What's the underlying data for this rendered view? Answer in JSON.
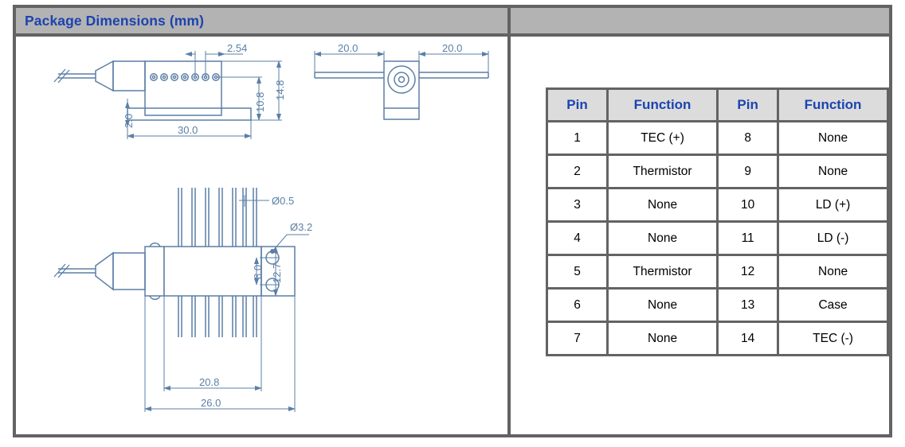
{
  "header": {
    "title": "Package Dimensions (mm)",
    "right_title": ""
  },
  "pin_table": {
    "columns": [
      "Pin",
      "Function",
      "Pin",
      "Function"
    ],
    "rows": [
      [
        "1",
        "TEC (+)",
        "8",
        "None"
      ],
      [
        "2",
        "Thermistor",
        "9",
        "None"
      ],
      [
        "3",
        "None",
        "10",
        "LD (+)"
      ],
      [
        "4",
        "None",
        "11",
        "LD (-)"
      ],
      [
        "5",
        "Thermistor",
        "12",
        "None"
      ],
      [
        "6",
        "None",
        "13",
        "Case"
      ],
      [
        "7",
        "None",
        "14",
        "TEC (-)"
      ]
    ]
  },
  "drawing": {
    "side_view": {
      "name": "side-view",
      "dimensions": {
        "pin_pitch": "2.54",
        "total_height": "14.8",
        "body_height": "10.8",
        "base_length": "30.0",
        "base_thickness": "2.0"
      }
    },
    "end_view": {
      "name": "end-view",
      "dimensions": {
        "flange_left": "20.0",
        "flange_right": "20.0"
      }
    },
    "top_view": {
      "name": "top-view",
      "dimensions": {
        "pin_diameter": "ø0.5",
        "hole_diameter": "ø3.2",
        "hole_spacing": "8.0",
        "flange_width": "12.7",
        "body_width": "20.8",
        "overall_width": "26.0"
      }
    }
  },
  "colors": {
    "title_blue": "#1c43b0",
    "drawing_blue": "#5b7fa6",
    "header_gray": "#b3b3b3",
    "border_gray": "#636363",
    "table_header_gray": "#dcdcdc"
  }
}
